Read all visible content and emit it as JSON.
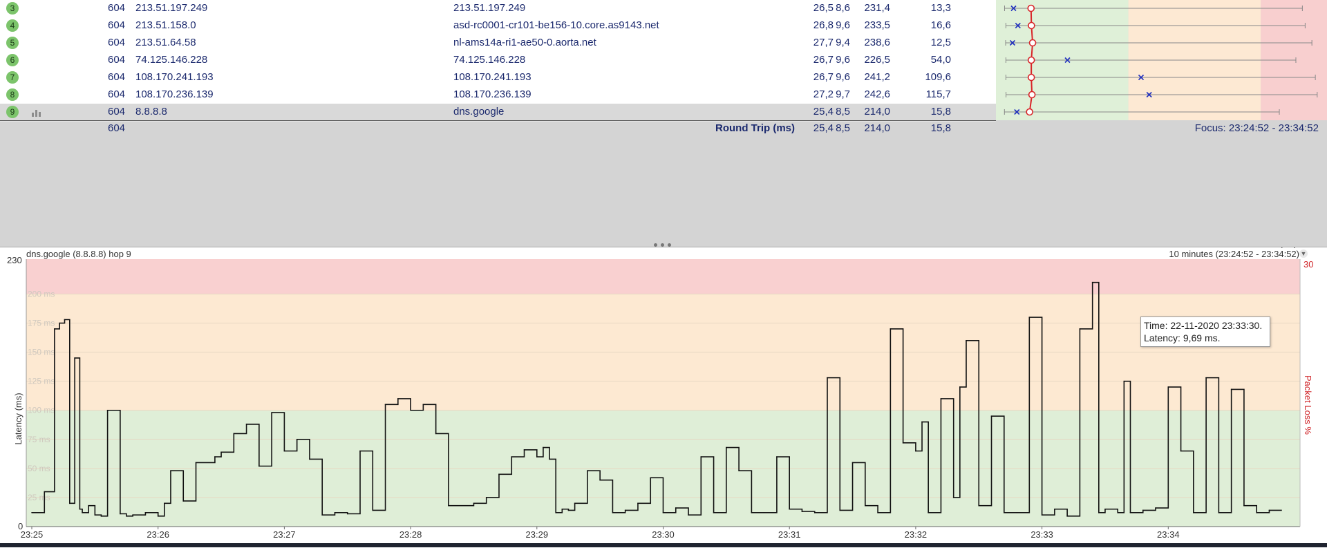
{
  "hops": [
    {
      "hop": "3",
      "sent": "604",
      "ip": "213.51.197.249",
      "name": "213.51.197.249",
      "avg": "26,5",
      "min": "8,6",
      "max": "231,4",
      "cur": "13,3",
      "loss_pct": 0,
      "avg_ms": 26.5,
      "min_ms": 8.6,
      "max_ms": 231.4,
      "cur_ms": 13.3
    },
    {
      "hop": "4",
      "sent": "604",
      "ip": "213.51.158.0",
      "name": "asd-rc0001-cr101-be156-10.core.as9143.net",
      "avg": "26,8",
      "min": "9,6",
      "max": "233,5",
      "cur": "16,6",
      "loss_pct": 0,
      "avg_ms": 26.8,
      "min_ms": 9.6,
      "max_ms": 233.5,
      "cur_ms": 16.6
    },
    {
      "hop": "5",
      "sent": "604",
      "ip": "213.51.64.58",
      "name": "nl-ams14a-ri1-ae50-0.aorta.net",
      "avg": "27,7",
      "min": "9,4",
      "max": "238,6",
      "cur": "12,5",
      "loss_pct": 0,
      "avg_ms": 27.7,
      "min_ms": 9.4,
      "max_ms": 238.6,
      "cur_ms": 12.5
    },
    {
      "hop": "6",
      "sent": "604",
      "ip": "74.125.146.228",
      "name": "74.125.146.228",
      "avg": "26,7",
      "min": "9,6",
      "max": "226,5",
      "cur": "54,0",
      "loss_pct": 0,
      "avg_ms": 26.7,
      "min_ms": 9.6,
      "max_ms": 226.5,
      "cur_ms": 54.0
    },
    {
      "hop": "7",
      "sent": "604",
      "ip": "108.170.241.193",
      "name": "108.170.241.193",
      "avg": "26,7",
      "min": "9,6",
      "max": "241,2",
      "cur": "109,6",
      "loss_pct": 0,
      "avg_ms": 26.7,
      "min_ms": 9.6,
      "max_ms": 241.2,
      "cur_ms": 109.6
    },
    {
      "hop": "8",
      "sent": "604",
      "ip": "108.170.236.139",
      "name": "108.170.236.139",
      "avg": "27,2",
      "min": "9,7",
      "max": "242,6",
      "cur": "115,7",
      "loss_pct": 0,
      "avg_ms": 27.2,
      "min_ms": 9.7,
      "max_ms": 242.6,
      "cur_ms": 115.7
    },
    {
      "hop": "9",
      "sent": "604",
      "ip": "8.8.8.8",
      "name": "dns.google",
      "avg": "25,4",
      "min": "8,5",
      "max": "214,0",
      "cur": "15,8",
      "loss_pct": 0,
      "avg_ms": 25.4,
      "min_ms": 8.5,
      "max_ms": 214.0,
      "cur_ms": 15.8
    }
  ],
  "summary": {
    "sent": "604",
    "label": "Round Trip (ms)",
    "avg": "25,4",
    "min": "8,5",
    "max": "214,0",
    "cur": "15,8",
    "focus": "Focus: 23:24:52 - 23:34:52"
  },
  "hop_graph_colors": {
    "green": "#dff0d8",
    "orange": "#fde9d3",
    "red": "#f8cfcf",
    "avg_line": "#d9262a",
    "marker": "#1f2fbf"
  },
  "graph": {
    "title": "dns.google (8.8.8.8) hop 9",
    "range_label": "10 minutes (23:24:52 - 23:34:52)",
    "y_axis_label": "Latency (ms)",
    "y2_axis_label": "Packet Loss %",
    "y_top": "230",
    "y_bottom": "0",
    "y2_top": "30",
    "ms_labels": [
      "200 ms",
      "175 ms",
      "150 ms",
      "125 ms",
      "100 ms",
      "75 ms",
      "50 ms",
      "25 ms"
    ],
    "time_labels": [
      "23:25",
      "23:26",
      "23:27",
      "23:28",
      "23:29",
      "23:30",
      "23:31",
      "23:32",
      "23:33",
      "23:34"
    ],
    "tooltip_time": "Time: 22-11-2020 23:33:30.",
    "tooltip_latency": "Latency: 9,69 ms."
  },
  "chart_data": {
    "type": "line",
    "title": "dns.google (8.8.8.8) hop 9",
    "xlabel": "",
    "ylabel": "Latency (ms)",
    "y2label": "Packet Loss %",
    "ylim": [
      0,
      230
    ],
    "y2lim": [
      0,
      30
    ],
    "x_ticks": [
      "23:25",
      "23:26",
      "23:27",
      "23:28",
      "23:29",
      "23:30",
      "23:31",
      "23:32",
      "23:33",
      "23:34"
    ],
    "bands": [
      {
        "from": 0,
        "to": 100,
        "color": "#dfeed7"
      },
      {
        "from": 100,
        "to": 200,
        "color": "#fde9d2"
      },
      {
        "from": 200,
        "to": 230,
        "color": "#f9d0d0"
      }
    ],
    "series": [
      {
        "x_minutes": [
          0.0,
          0.1,
          0.18,
          0.22,
          0.26,
          0.3,
          0.34,
          0.38,
          0.4,
          0.45,
          0.5,
          0.55,
          0.6,
          0.7,
          0.75,
          0.8,
          0.9,
          1.0,
          1.05,
          1.1,
          1.2,
          1.3,
          1.45,
          1.5,
          1.6,
          1.7,
          1.8,
          1.9,
          2.0,
          2.1,
          2.2,
          2.3,
          2.4,
          2.5,
          2.6,
          2.7,
          2.8,
          2.9,
          3.0,
          3.1,
          3.2,
          3.3,
          3.5,
          3.6,
          3.7,
          3.8,
          3.9,
          4.0,
          4.05,
          4.1,
          4.15,
          4.2,
          4.25,
          4.3,
          4.4,
          4.5,
          4.6,
          4.7,
          4.8,
          4.9,
          5.0,
          5.1,
          5.2,
          5.3,
          5.4,
          5.5,
          5.6,
          5.7,
          5.8,
          5.9,
          6.0,
          6.1,
          6.2,
          6.3,
          6.4,
          6.5,
          6.6,
          6.7,
          6.8,
          6.9,
          7.0,
          7.05,
          7.1,
          7.2,
          7.3,
          7.35,
          7.4,
          7.5,
          7.6,
          7.7,
          7.8,
          7.9,
          8.0,
          8.1,
          8.2,
          8.3,
          8.4,
          8.45,
          8.5,
          8.6,
          8.65,
          8.7,
          8.8,
          8.9,
          9.0,
          9.1,
          9.2,
          9.3,
          9.4,
          9.5,
          9.6,
          9.7,
          9.8,
          9.9,
          10.0
        ],
        "latency_ms": [
          12,
          30,
          170,
          175,
          178,
          20,
          145,
          15,
          12,
          18,
          10,
          9,
          100,
          11,
          9,
          10,
          12,
          9,
          20,
          48,
          22,
          55,
          60,
          64,
          80,
          88,
          52,
          98,
          65,
          75,
          58,
          10,
          12,
          11,
          65,
          14,
          105,
          110,
          100,
          105,
          80,
          18,
          20,
          25,
          45,
          60,
          66,
          60,
          68,
          58,
          12,
          15,
          14,
          20,
          48,
          40,
          12,
          14,
          20,
          42,
          12,
          16,
          10,
          60,
          12,
          68,
          48,
          12,
          12,
          60,
          15,
          13,
          12,
          128,
          14,
          55,
          18,
          12,
          170,
          72,
          65,
          90,
          12,
          110,
          25,
          120,
          160,
          18,
          95,
          12,
          12,
          180,
          10,
          15,
          9,
          170,
          210,
          12,
          15,
          12,
          125,
          12,
          14,
          16,
          120,
          65,
          12,
          128,
          12,
          118,
          18,
          12,
          14
        ],
        "name": ""
      }
    ]
  }
}
